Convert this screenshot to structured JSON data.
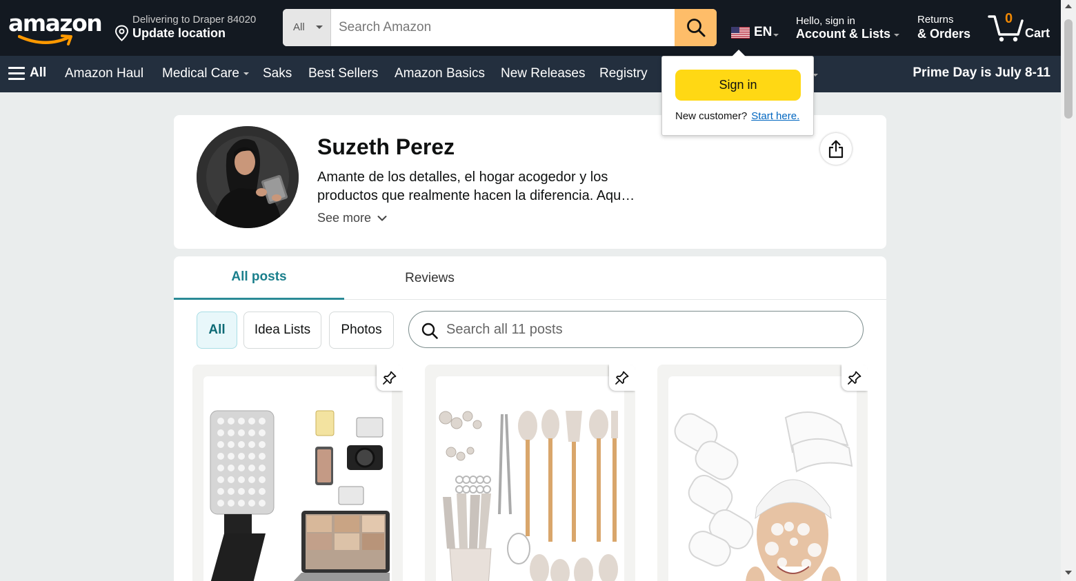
{
  "header": {
    "logo_text": "amazon",
    "delivery_line1": "Delivering to Draper 84020",
    "delivery_line2": "Update location",
    "search_category": "All",
    "search_placeholder": "Search Amazon",
    "language": "EN",
    "account_line1": "Hello, sign in",
    "account_line2": "Account & Lists",
    "returns_line1": "Returns",
    "returns_line2": "& Orders",
    "cart_count": "0",
    "cart_label": "Cart",
    "icons": {
      "location": "map-pin-icon",
      "search": "magnifier-icon",
      "flag": "us-flag-icon",
      "cart": "cart-icon"
    },
    "colors": {
      "bar": "#131921",
      "search_button": "#febd69",
      "cart_count": "#f08804"
    }
  },
  "nav": {
    "all_label": "All",
    "items": [
      "Amazon Haul",
      "Medical Care",
      "Saks",
      "Best Sellers",
      "Amazon Basics",
      "New Releases",
      "Registry"
    ],
    "promo": "Prime Day is July 8-11",
    "colors": {
      "bar": "#232f3e"
    }
  },
  "signin_flyout": {
    "button_label": "Sign in",
    "new_customer_text": "New customer?",
    "start_link": "Start here."
  },
  "profile": {
    "name": "Suzeth Perez",
    "bio_line1": "Amante de los detalles, el hogar acogedor y los",
    "bio_line2": "productos que realmente hacen la diferencia. Aqu…",
    "see_more": "See more",
    "icons": {
      "share": "share-icon",
      "see_more": "chevron-down-icon"
    }
  },
  "posts": {
    "tabs": [
      "All posts",
      "Reviews"
    ],
    "active_tab": "All posts",
    "filters": [
      "All",
      "Idea Lists",
      "Photos"
    ],
    "active_filter": "All",
    "search_placeholder": "Search all 11 posts",
    "cards": [
      {
        "image": "led-video-light-product-photo",
        "pin_icon": "pin-icon"
      },
      {
        "image": "kitchen-utensil-set-product-photo",
        "pin_icon": "pin-icon"
      },
      {
        "image": "spa-headband-product-photo",
        "pin_icon": "pin-icon"
      }
    ],
    "colors": {
      "accent": "#1a7f8c",
      "chip_active_bg": "#e8f7fa"
    }
  }
}
